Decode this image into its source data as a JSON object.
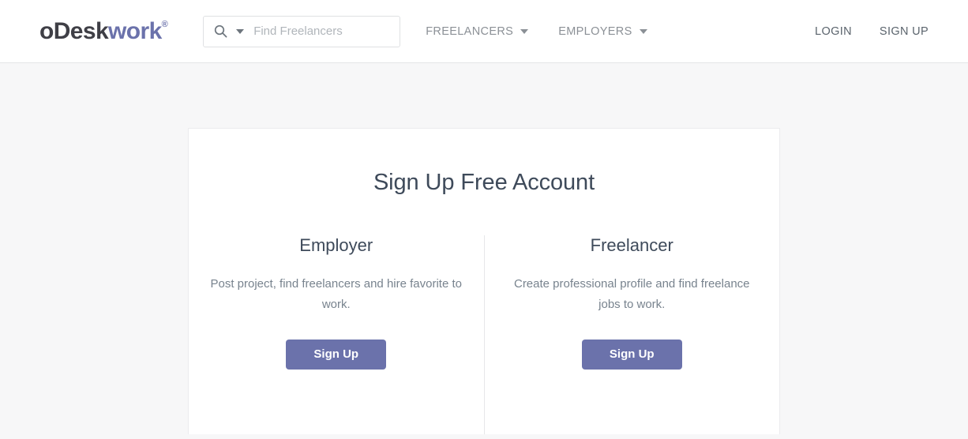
{
  "header": {
    "logo": {
      "part1": "oDesk",
      "part2": "work",
      "registered": "®",
      "color_dark": "#3f3f46",
      "color_accent": "#6b72ab"
    },
    "search": {
      "icon": "search-icon",
      "caret": "chevron-down-icon",
      "value": "",
      "placeholder": "Find Freelancers"
    },
    "nav": [
      {
        "label": "FREELANCERS",
        "caret": "chevron-down-icon"
      },
      {
        "label": "EMPLOYERS",
        "caret": "chevron-down-icon"
      }
    ],
    "auth": [
      {
        "label": "LOGIN"
      },
      {
        "label": "SIGN UP"
      }
    ]
  },
  "main": {
    "title": "Sign Up Free Account",
    "accent_color": "#6b72ab",
    "options": [
      {
        "title": "Employer",
        "description": "Post project, find freelancers and hire favorite to work.",
        "button": "Sign Up"
      },
      {
        "title": "Freelancer",
        "description": "Create professional profile and find freelance jobs to work.",
        "button": "Sign Up"
      }
    ]
  }
}
